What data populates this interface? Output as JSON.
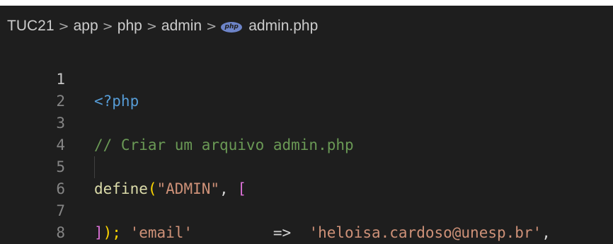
{
  "breadcrumb": {
    "items": [
      "TUC21",
      "app",
      "php",
      "admin"
    ],
    "separator": ">",
    "file_icon": "php-file-icon",
    "file_icon_text": "php",
    "file_name": "admin.php"
  },
  "editor": {
    "language": "php",
    "active_line": 1,
    "lines": [
      {
        "number": "1",
        "text": "<?php"
      },
      {
        "number": "2",
        "text": ""
      },
      {
        "number": "3",
        "text": "// Criar um arquivo admin.php"
      },
      {
        "number": "4",
        "text": ""
      },
      {
        "number": "5",
        "text": "define(\"ADMIN\", ["
      },
      {
        "number": "6",
        "text": "    'email'         =>  'heloisa.cardoso@unesp.br',"
      },
      {
        "number": "7",
        "text": "]);"
      },
      {
        "number": "8",
        "text": ""
      }
    ],
    "tokens": {
      "php_open": "<?php",
      "comment": "// Criar um arquivo admin.php",
      "define_fn": "define",
      "paren_open": "(",
      "admin_const": "\"ADMIN\"",
      "comma_space": ", ",
      "bracket_open": "[",
      "email_key": "'email'",
      "arrow": "=>",
      "email_value": "'heloisa.cardoso@unesp.br'",
      "trailing_comma": ",",
      "bracket_close": "]",
      "paren_close_semi": ");"
    }
  },
  "colors": {
    "background": "#1e1e1e",
    "line_number": "#858585",
    "line_number_active": "#c6c6c6",
    "keyword_tag": "#569cd6",
    "comment": "#6a9955",
    "function": "#dcdcaa",
    "string": "#ce9178",
    "bracket_level1": "#da70d6",
    "bracket_level2": "#ffd700"
  }
}
